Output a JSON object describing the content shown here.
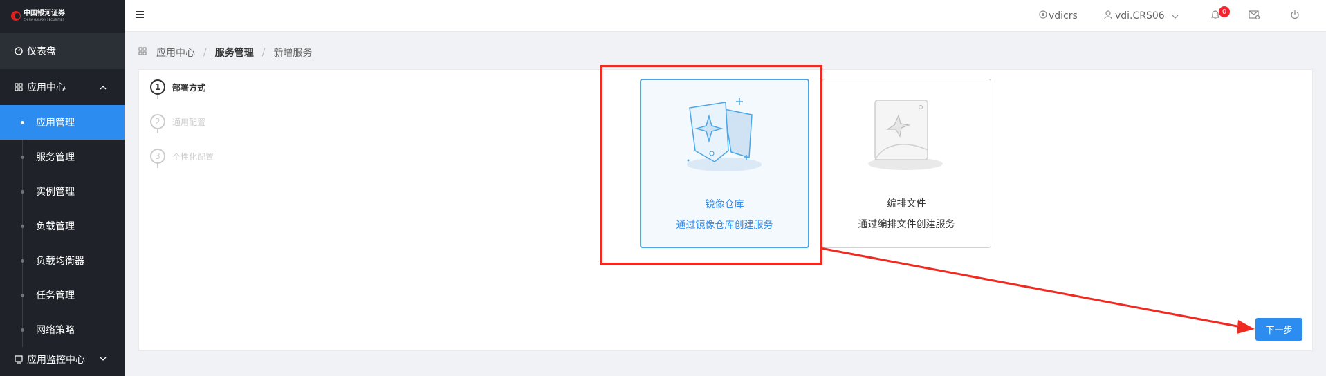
{
  "logo": {
    "name_cn": "中国银河证券",
    "name_en": "CHINA GALAXY SECURITIES"
  },
  "sidebar": {
    "dashboard": {
      "label": "仪表盘",
      "icon": "dashboard-icon"
    },
    "app_center": {
      "label": "应用中心",
      "icon": "grid-icon",
      "expanded": true
    },
    "items": [
      {
        "label": "应用管理",
        "active": true
      },
      {
        "label": "服务管理"
      },
      {
        "label": "实例管理"
      },
      {
        "label": "负载管理"
      },
      {
        "label": "负载均衡器"
      },
      {
        "label": "任务管理"
      },
      {
        "label": "网络策略"
      }
    ],
    "monitor_center": {
      "label": "应用监控中心",
      "icon": "monitor-icon"
    }
  },
  "header": {
    "tenant": "vdicrs",
    "user": "vdi.CRS06",
    "notification_count": "0"
  },
  "breadcrumb": {
    "items": [
      "应用中心",
      "服务管理",
      "新增服务"
    ]
  },
  "steps": [
    {
      "num": "1",
      "label": "部署方式",
      "active": true
    },
    {
      "num": "2",
      "label": "通用配置",
      "active": false
    },
    {
      "num": "3",
      "label": "个性化配置",
      "active": false
    }
  ],
  "options": [
    {
      "title": "镜像仓库",
      "desc": "通过镜像仓库创建服务",
      "selected": true
    },
    {
      "title": "编排文件",
      "desc": "通过编排文件创建服务",
      "selected": false
    }
  ],
  "next_button": "下一步",
  "colors": {
    "accent": "#2d8cf0",
    "sidebar_bg": "#1f2329",
    "annotation": "#f02a20"
  }
}
